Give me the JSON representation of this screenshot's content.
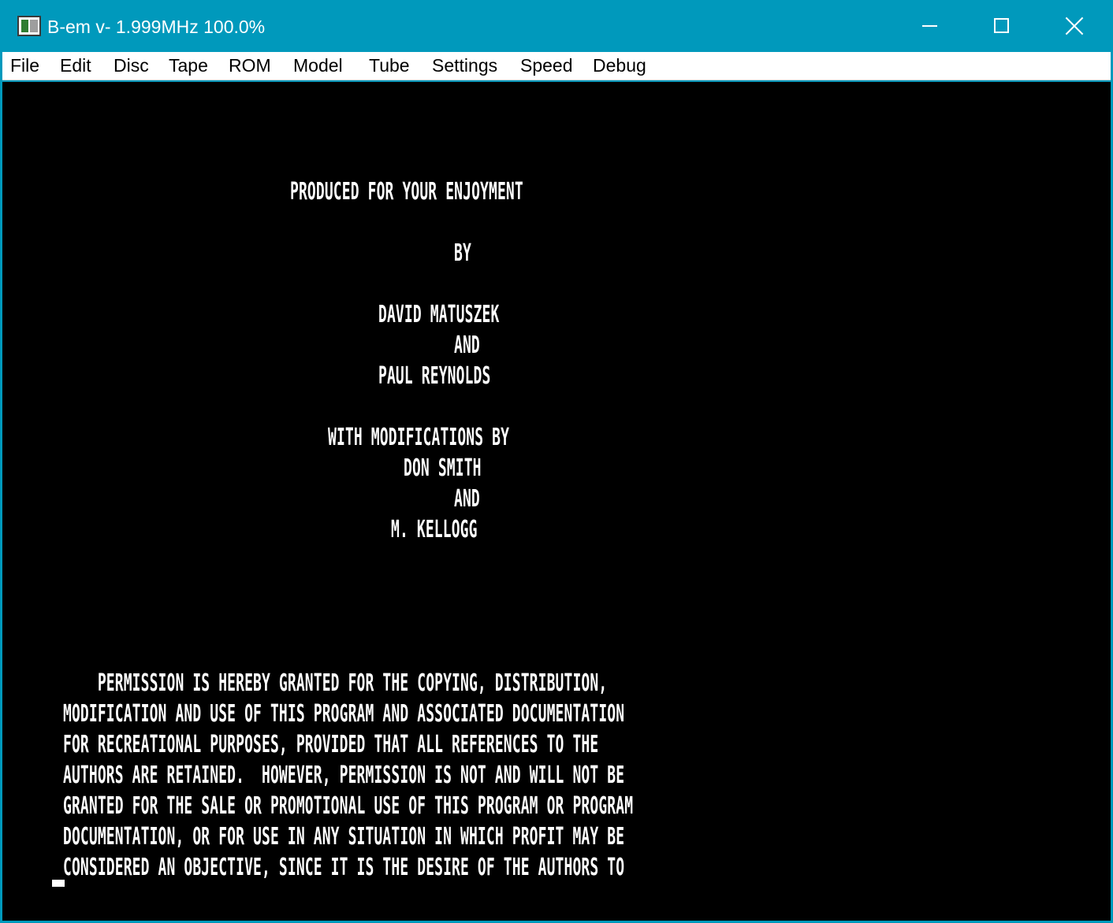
{
  "window": {
    "title": "B-em v- 1.999MHz 100.0%",
    "title_bar_color": "#0099bc"
  },
  "icons": {
    "app": "app-icon",
    "minimize": "minimize-icon",
    "maximize": "maximize-icon",
    "close": "close-icon"
  },
  "menu": {
    "items": [
      "File",
      "Edit",
      "Disc",
      "Tape",
      "ROM",
      "Model",
      "Tube",
      "Settings",
      "Speed",
      "Debug"
    ]
  },
  "screen": {
    "background": "#000000",
    "foreground": "#ffffff",
    "credits": [
      "PRODUCED FOR YOUR ENJOYMENT",
      "BY",
      "DAVID MATUSZEK",
      "AND",
      "PAUL REYNOLDS",
      "WITH MODIFICATIONS BY",
      "DON SMITH",
      "AND",
      "M. KELLOGG"
    ],
    "permission": [
      "    PERMISSION IS HEREBY GRANTED FOR THE COPYING, DISTRIBUTION,",
      "MODIFICATION AND USE OF THIS PROGRAM AND ASSOCIATED DOCUMENTATION",
      "FOR RECREATIONAL PURPOSES, PROVIDED THAT ALL REFERENCES TO THE",
      "AUTHORS ARE RETAINED.  HOWEVER, PERMISSION IS NOT AND WILL NOT BE",
      "GRANTED FOR THE SALE OR PROMOTIONAL USE OF THIS PROGRAM OR PROGRAM",
      "DOCUMENTATION, OR FOR USE IN ANY SITUATION IN WHICH PROFIT MAY BE",
      "CONSIDERED AN OBJECTIVE, SINCE IT IS THE DESIRE OF THE AUTHORS TO"
    ]
  }
}
